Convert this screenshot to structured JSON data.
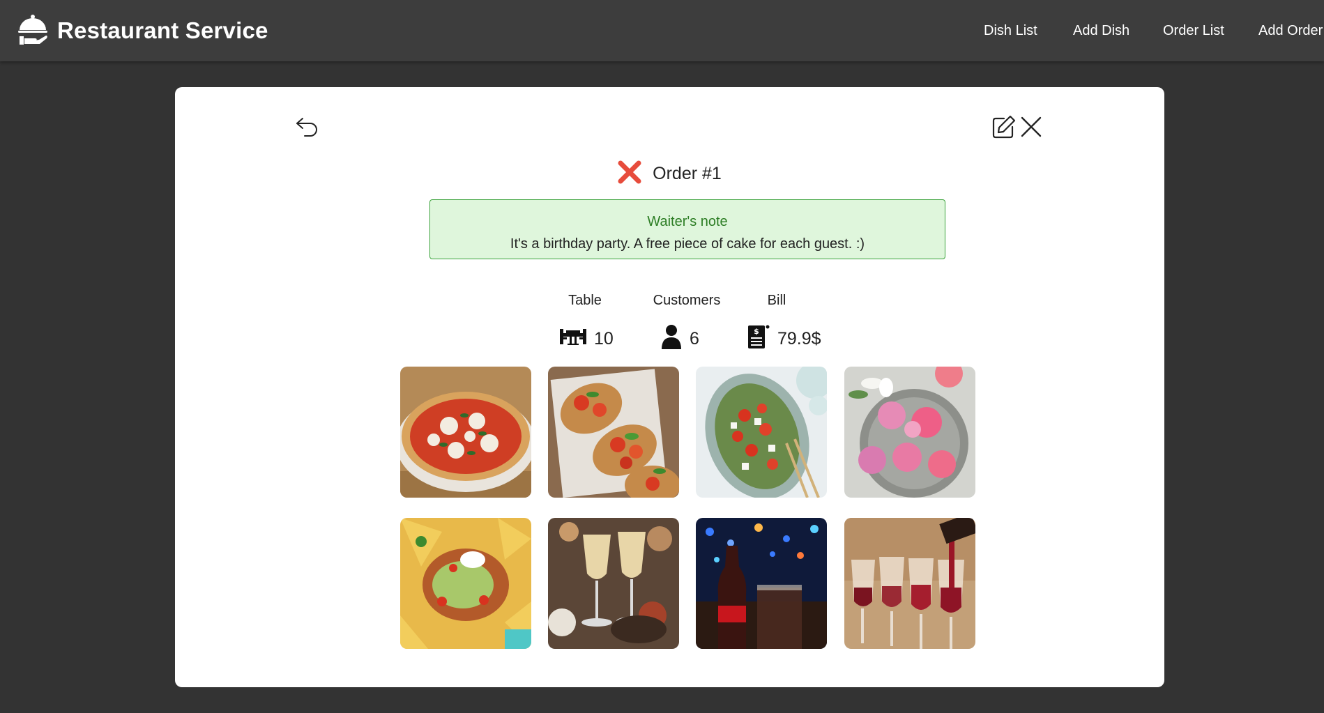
{
  "navbar": {
    "brand_title": "Restaurant Service",
    "links": [
      "Dish List",
      "Add Dish",
      "Order List",
      "Add Order"
    ]
  },
  "order": {
    "title": "Order #1",
    "status_icon": "x-mark-icon",
    "status_color": "#e74c3c",
    "note": {
      "title": "Waiter's note",
      "text": "It's a birthday party. A free piece of cake for each guest. :)"
    },
    "stats": {
      "table_label": "Table",
      "table_value": "10",
      "customers_label": "Customers",
      "customers_value": "6",
      "bill_label": "Bill",
      "bill_value": "79.9$"
    },
    "dishes": [
      "pizza",
      "bruschetta",
      "greek-salad",
      "macarons",
      "nachos",
      "champagne",
      "cola",
      "red-wine"
    ]
  },
  "colors": {
    "navbar": "#3d3d3d",
    "background": "#333333",
    "note_background": "#dff6dc",
    "note_border": "#3aa23a",
    "note_title": "#2c7d24"
  }
}
